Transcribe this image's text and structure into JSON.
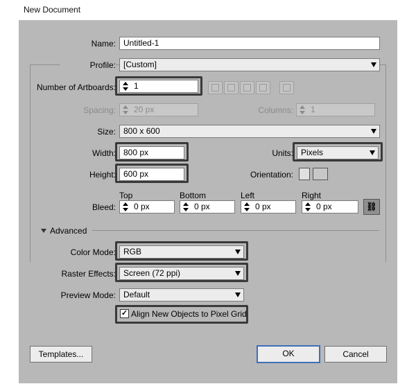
{
  "window": {
    "title": "New Document"
  },
  "name": {
    "label": "Name:",
    "value": "Untitled-1"
  },
  "profile": {
    "label": "Profile:",
    "value": "[Custom]"
  },
  "artboards": {
    "label": "Number of Artboards:",
    "value": "1"
  },
  "spacing": {
    "label": "Spacing:",
    "value": "20 px"
  },
  "columns": {
    "label": "Columns:",
    "value": "1"
  },
  "size": {
    "label": "Size:",
    "value": "800 x 600"
  },
  "width": {
    "label": "Width:",
    "value": "800 px"
  },
  "units": {
    "label": "Units:",
    "value": "Pixels"
  },
  "height": {
    "label": "Height:",
    "value": "600 px"
  },
  "orientation": {
    "label": "Orientation:",
    "icons": [
      "portrait-icon",
      "landscape-icon"
    ]
  },
  "bleed": {
    "label": "Bleed:",
    "top": {
      "label": "Top",
      "value": "0 px"
    },
    "bottom": {
      "label": "Bottom",
      "value": "0 px"
    },
    "left": {
      "label": "Left",
      "value": "0 px"
    },
    "right": {
      "label": "Right",
      "value": "0 px"
    }
  },
  "advanced": {
    "label": "Advanced"
  },
  "color_mode": {
    "label": "Color Mode:",
    "value": "RGB"
  },
  "raster_effects": {
    "label": "Raster Effects:",
    "value": "Screen (72 ppi)"
  },
  "preview_mode": {
    "label": "Preview Mode:",
    "value": "Default"
  },
  "align_pixel_grid": {
    "label": "Align New Objects to Pixel Grid",
    "checked": true
  },
  "buttons": {
    "templates": "Templates...",
    "ok": "OK",
    "cancel": "Cancel"
  },
  "colors": {
    "dialog_bg": "#b8b8b8",
    "highlight": "#3a3a3a",
    "ok_border": "#3c6fb8"
  }
}
